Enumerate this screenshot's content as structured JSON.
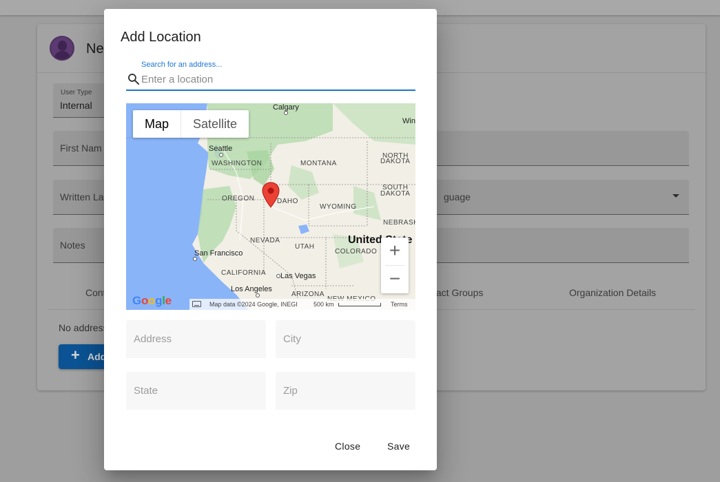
{
  "background": {
    "card_title": "Ne",
    "user_type": {
      "label": "User Type",
      "value": "Internal"
    },
    "first_name_label": "First Nam",
    "written_label": "Written La",
    "language_label": "guage",
    "notes_label": "Notes",
    "tabs": [
      "Cont",
      "tact Groups",
      "Organization Details"
    ],
    "no_address_text": "No address",
    "add_button_label": "Add"
  },
  "dialog": {
    "title": "Add Location",
    "search": {
      "label": "Search for an address...",
      "placeholder": "Enter a location"
    },
    "map": {
      "type_buttons": [
        "Map",
        "Satellite"
      ],
      "active_type": "Map",
      "zoom_in": "+",
      "zoom_out": "−",
      "labels": {
        "calgary": "Calgary",
        "win": "Win",
        "seattle": "Seattle",
        "washington": "WASHINGTON",
        "montana": "MONTANA",
        "north": "NORTH",
        "dakota_n": "DAKOTA",
        "south": "SOUTH",
        "dakota_s": "DAKOTA",
        "oregon": "OREGON",
        "idaho": "DAHO",
        "wyoming": "WYOMING",
        "nebraska": "NEBRASK",
        "nevada": "NEVADA",
        "utah": "UTAH",
        "united_states": "United State",
        "colorado": "COLORADO",
        "san_francisco": "San Francisco",
        "california": "CALIFORNIA",
        "las_vegas": "Las Vegas",
        "los_angeles": "Los Angeles",
        "arizona": "ARIZONA",
        "new_mexico": "NEW MEXICO"
      },
      "google_logo": "Google",
      "attribution": "Map data ©2024 Google, INEGI",
      "scale": "500 km",
      "terms": "Terms"
    },
    "fields": {
      "address_placeholder": "Address",
      "city_placeholder": "City",
      "state_placeholder": "State",
      "zip_placeholder": "Zip"
    },
    "close_label": "Close",
    "save_label": "Save"
  },
  "colors": {
    "accent": "#1976d2",
    "water": "#8ab4f8",
    "land": "#f2efe6",
    "park": "#b8dcb0",
    "marker": "#ea4335"
  }
}
